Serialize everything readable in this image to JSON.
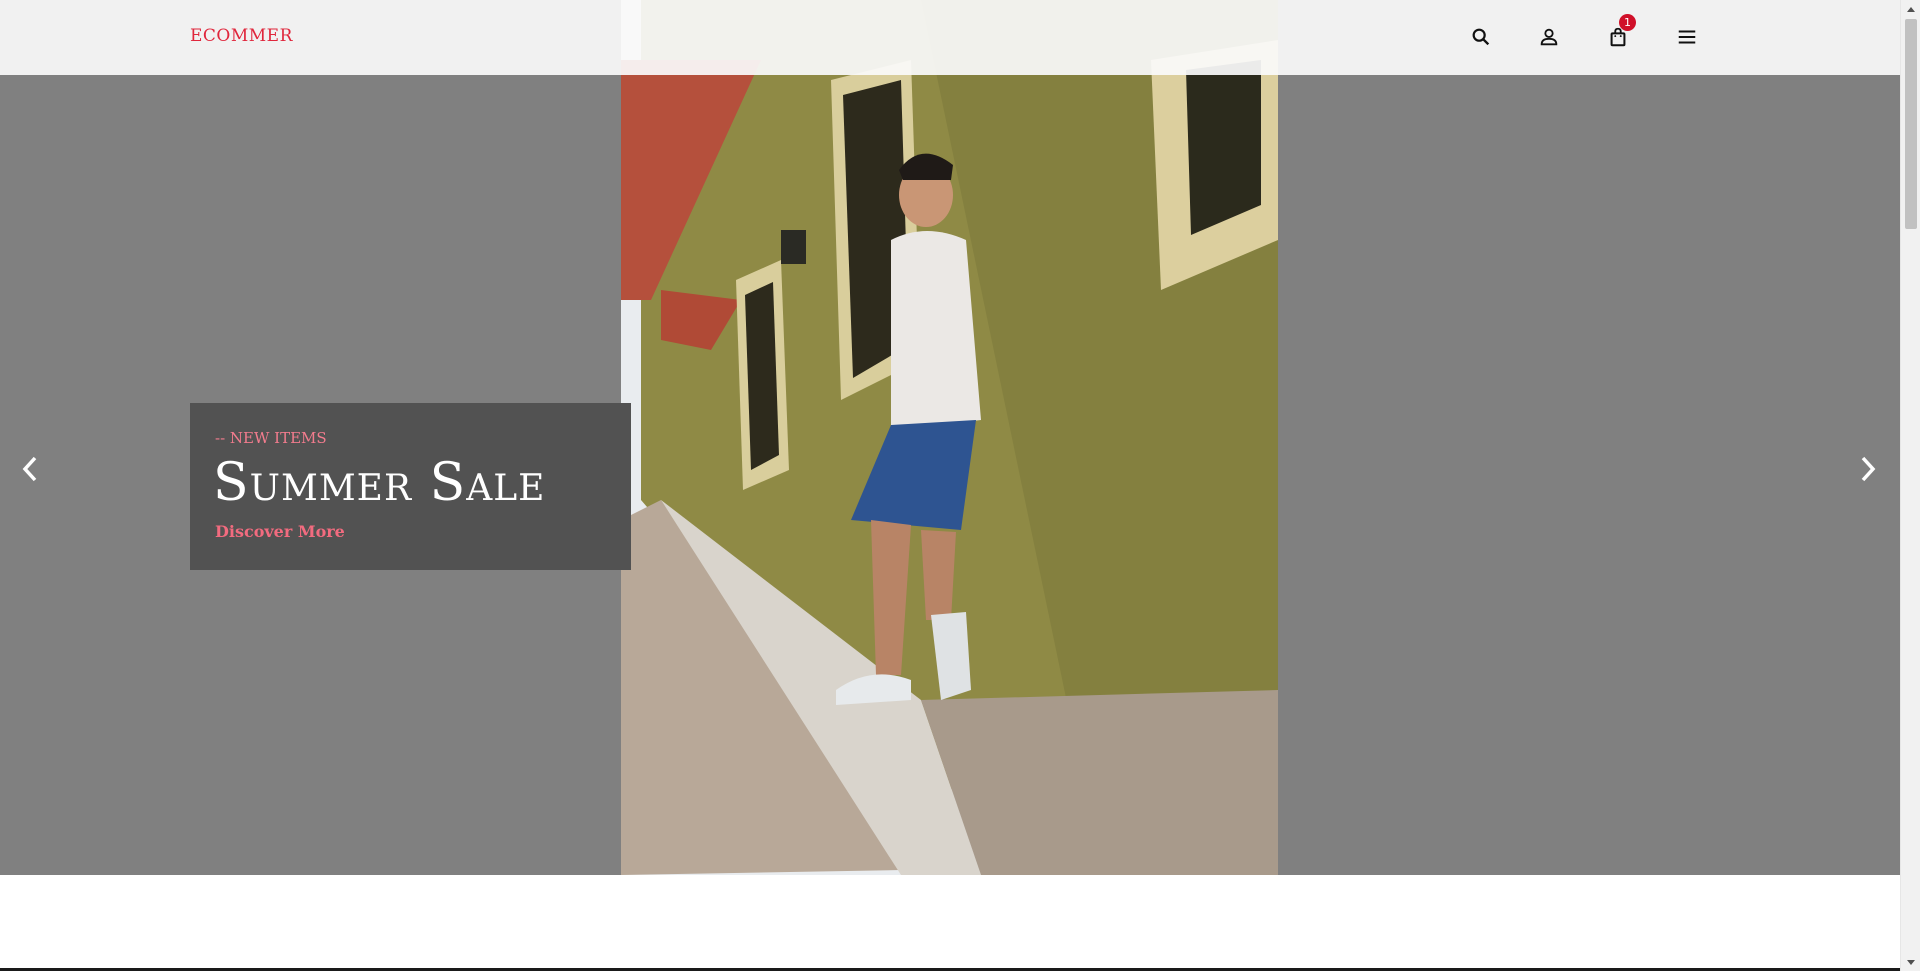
{
  "header": {
    "logo": "ECOMMER",
    "icons": [
      "search-icon",
      "user-icon",
      "shopping-bag-icon",
      "menu-icon"
    ],
    "cart_count": "1"
  },
  "slide": {
    "subtitle": "-- NEW ITEMS",
    "title": "Summer Sale",
    "cta": "Discover More"
  },
  "colors": {
    "brand": "#e0263c",
    "badge": "#d01029",
    "hero_bg": "#808080",
    "caption_bg": "#525252",
    "accent_text": "#f26b7f"
  }
}
